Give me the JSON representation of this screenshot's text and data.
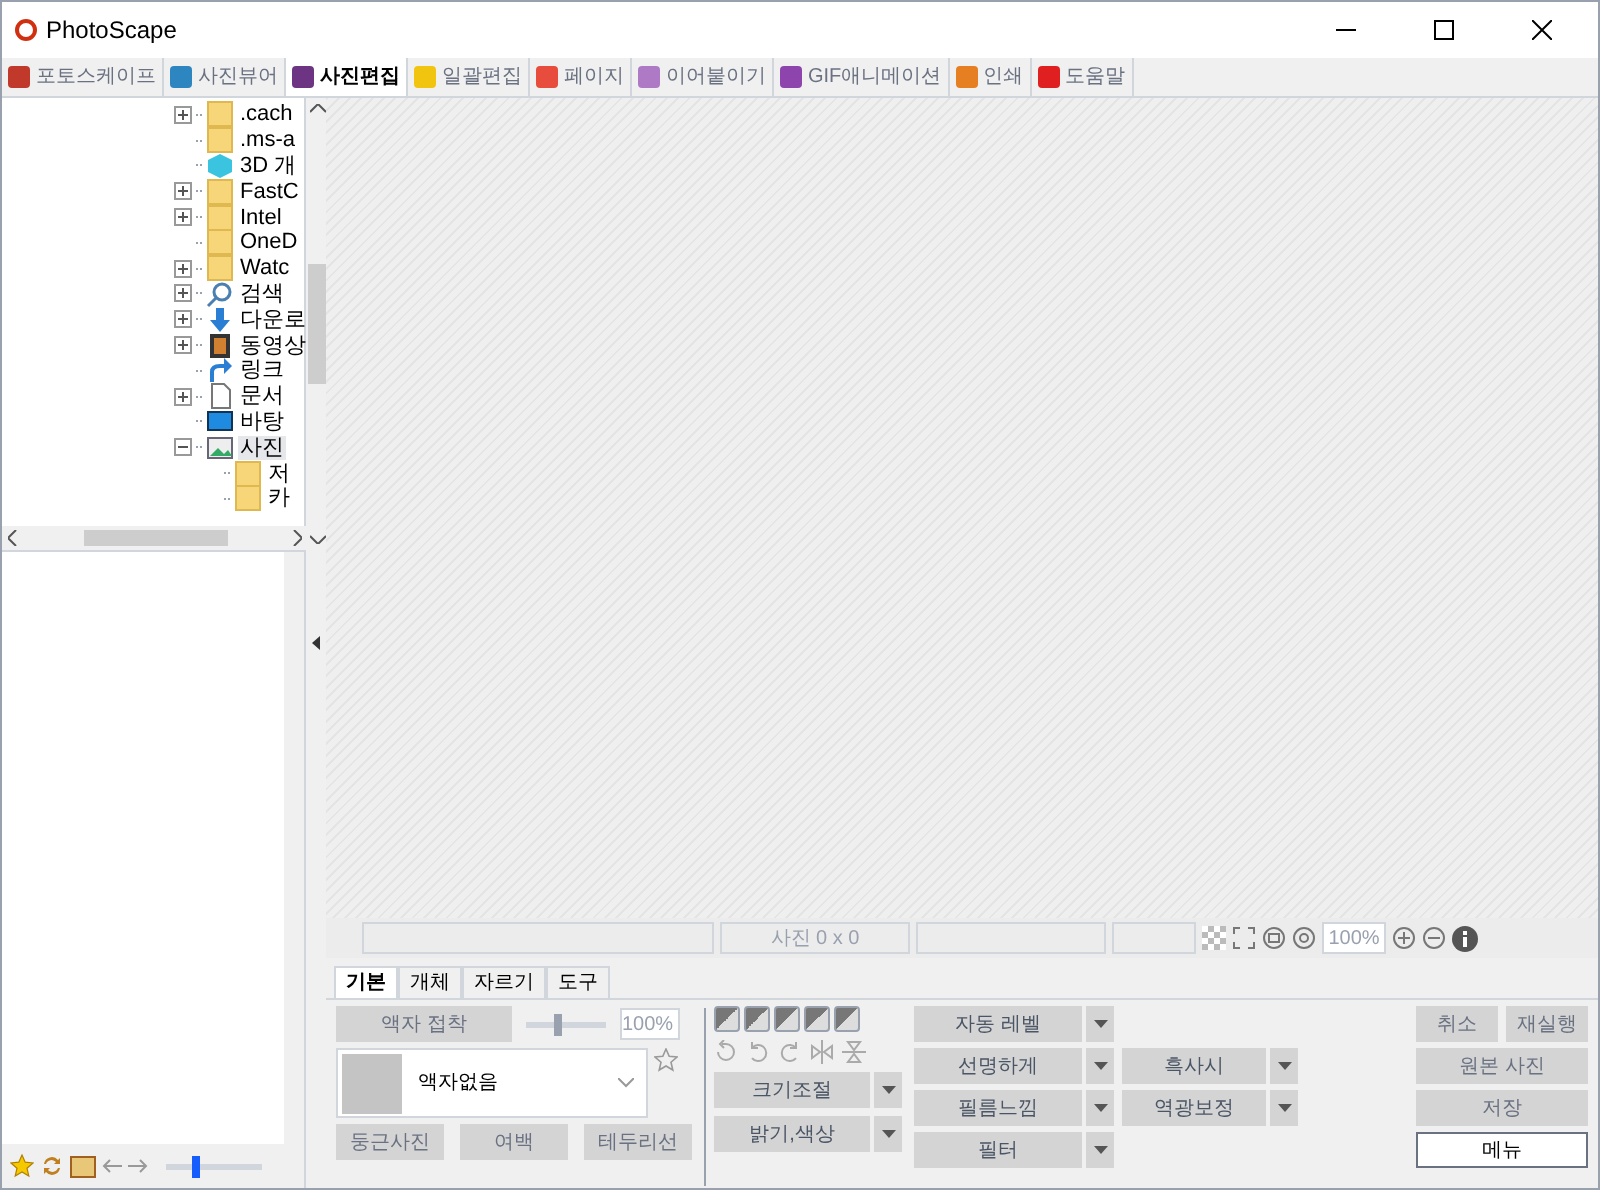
{
  "window": {
    "title": "PhotoScape"
  },
  "tabs": [
    {
      "label": "포토스케이프",
      "selected": false,
      "color": "#c0392b"
    },
    {
      "label": "사진뷰어",
      "selected": false,
      "color": "#2e86c1"
    },
    {
      "label": "사진편집",
      "selected": true,
      "color": "#6c3483"
    },
    {
      "label": "일괄편집",
      "selected": false,
      "color": "#f1c40f"
    },
    {
      "label": "페이지",
      "selected": false,
      "color": "#e74c3c"
    },
    {
      "label": "이어붙이기",
      "selected": false,
      "color": "#af7ac5"
    },
    {
      "label": "GIF애니메이션",
      "selected": false,
      "color": "#8e44ad"
    },
    {
      "label": "인쇄",
      "selected": false,
      "color": "#e67e22"
    },
    {
      "label": "도움말",
      "selected": false,
      "color": "#e02020"
    }
  ],
  "tree": [
    {
      "label": ".cach",
      "kind": "folder",
      "expanded": false
    },
    {
      "label": ".ms-a",
      "kind": "folder"
    },
    {
      "label": "3D 개",
      "kind": "cube"
    },
    {
      "label": "FastC",
      "kind": "folder",
      "expanded": false
    },
    {
      "label": "Intel",
      "kind": "folder",
      "expanded": false
    },
    {
      "label": "OneD",
      "kind": "folder"
    },
    {
      "label": "Watc",
      "kind": "folder",
      "expanded": false
    },
    {
      "label": "검색",
      "kind": "search",
      "expanded": false
    },
    {
      "label": "다운로",
      "kind": "download",
      "expanded": false
    },
    {
      "label": "동영상",
      "kind": "film",
      "expanded": false
    },
    {
      "label": "링크",
      "kind": "link"
    },
    {
      "label": "문서",
      "kind": "doc",
      "expanded": false
    },
    {
      "label": "바탕",
      "kind": "desktop"
    },
    {
      "label": "사진",
      "kind": "picture",
      "expanded": true,
      "selected": true,
      "children": [
        {
          "label": "저",
          "kind": "folder"
        },
        {
          "label": "카",
          "kind": "folder"
        }
      ]
    }
  ],
  "thumb_size": {
    "level": 0.3
  },
  "status_bar": {
    "size": "사진 0 x 0",
    "zoom": "100%"
  },
  "tool_tabs": [
    {
      "label": "기본",
      "selected": true
    },
    {
      "label": "개체",
      "selected": false
    },
    {
      "label": "자르기",
      "selected": false
    },
    {
      "label": "도구",
      "selected": false
    }
  ],
  "frame": {
    "make_button": "액자 접착",
    "scale": {
      "level": 0.4
    },
    "percent": "100%",
    "selection": "액자없음",
    "buttons": [
      "둥근사진",
      "여백",
      "테두리선"
    ]
  },
  "adjust": {
    "dropdowns": [
      {
        "label": "크기조절"
      },
      {
        "label": "밝기,색상"
      }
    ],
    "right_dropdowns": [
      {
        "label": "자동 레벨"
      },
      {
        "label": "선명하게"
      },
      {
        "label": "필름느낌"
      },
      {
        "label": "필터"
      }
    ],
    "third_dropdowns": [
      {
        "label": "흑사시"
      },
      {
        "label": "역광보정"
      }
    ]
  },
  "actions": {
    "undo": "취소",
    "redo": "재실행",
    "original": "원본 사진",
    "save": "저장",
    "menu": "메뉴"
  }
}
